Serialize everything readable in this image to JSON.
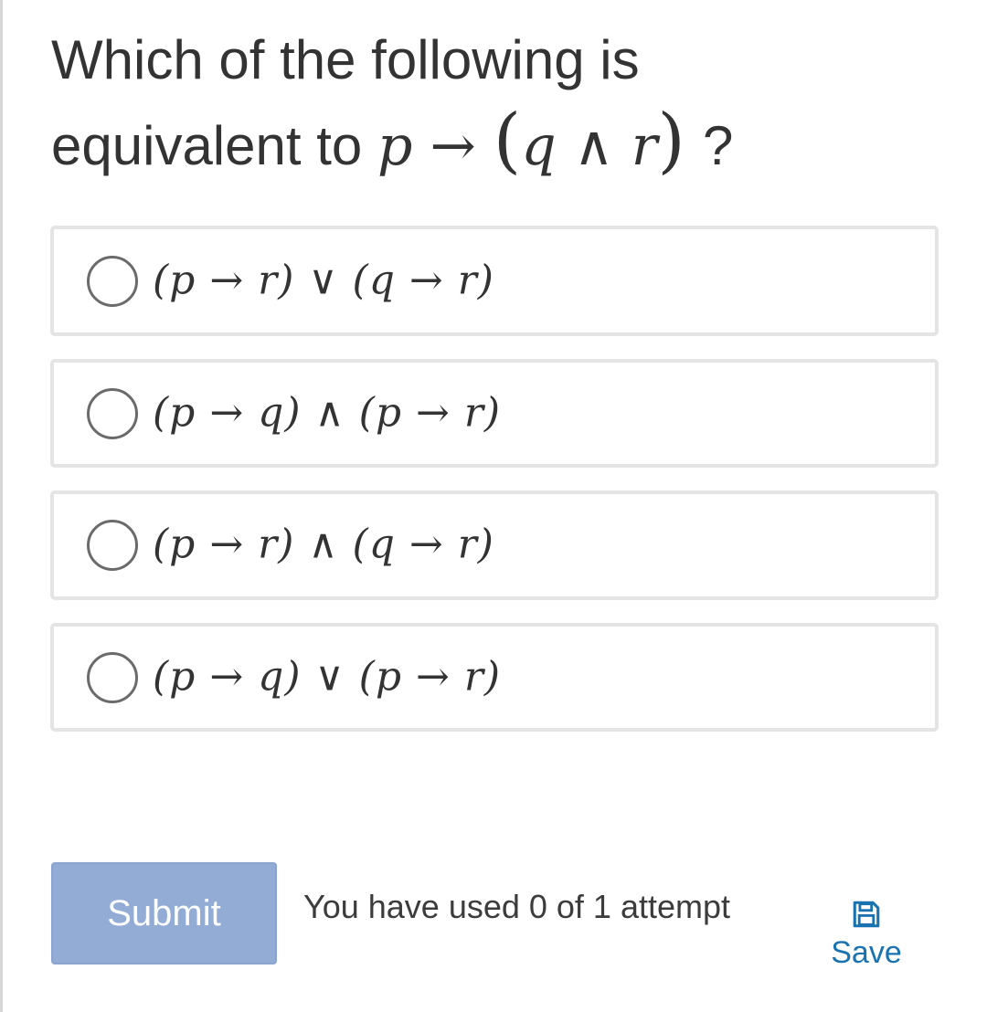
{
  "question": {
    "text_line1": "Which of the following is",
    "text_line2_prefix": "equivalent to",
    "formula": {
      "p": "p",
      "arrow": "→",
      "open_paren": "(",
      "q": "q",
      "and": "∧",
      "r": "r",
      "close_paren": ")"
    },
    "suffix": "?"
  },
  "options": [
    {
      "label": "(p → r) ∨ (q → r)"
    },
    {
      "label": "(p → q) ∧ (p → r)"
    },
    {
      "label": "(p → r) ∧ (q → r)"
    },
    {
      "label": "(p → q) ∨ (p → r)"
    }
  ],
  "footer": {
    "submit_label": "Submit",
    "attempts_text": "You have used 0 of 1 attempt",
    "save_label": "Save",
    "save_icon": "floppy-disk-icon"
  },
  "colors": {
    "submit_bg": "#92acd5",
    "save_link": "#1a73b0",
    "option_border": "#e4e4e4"
  }
}
